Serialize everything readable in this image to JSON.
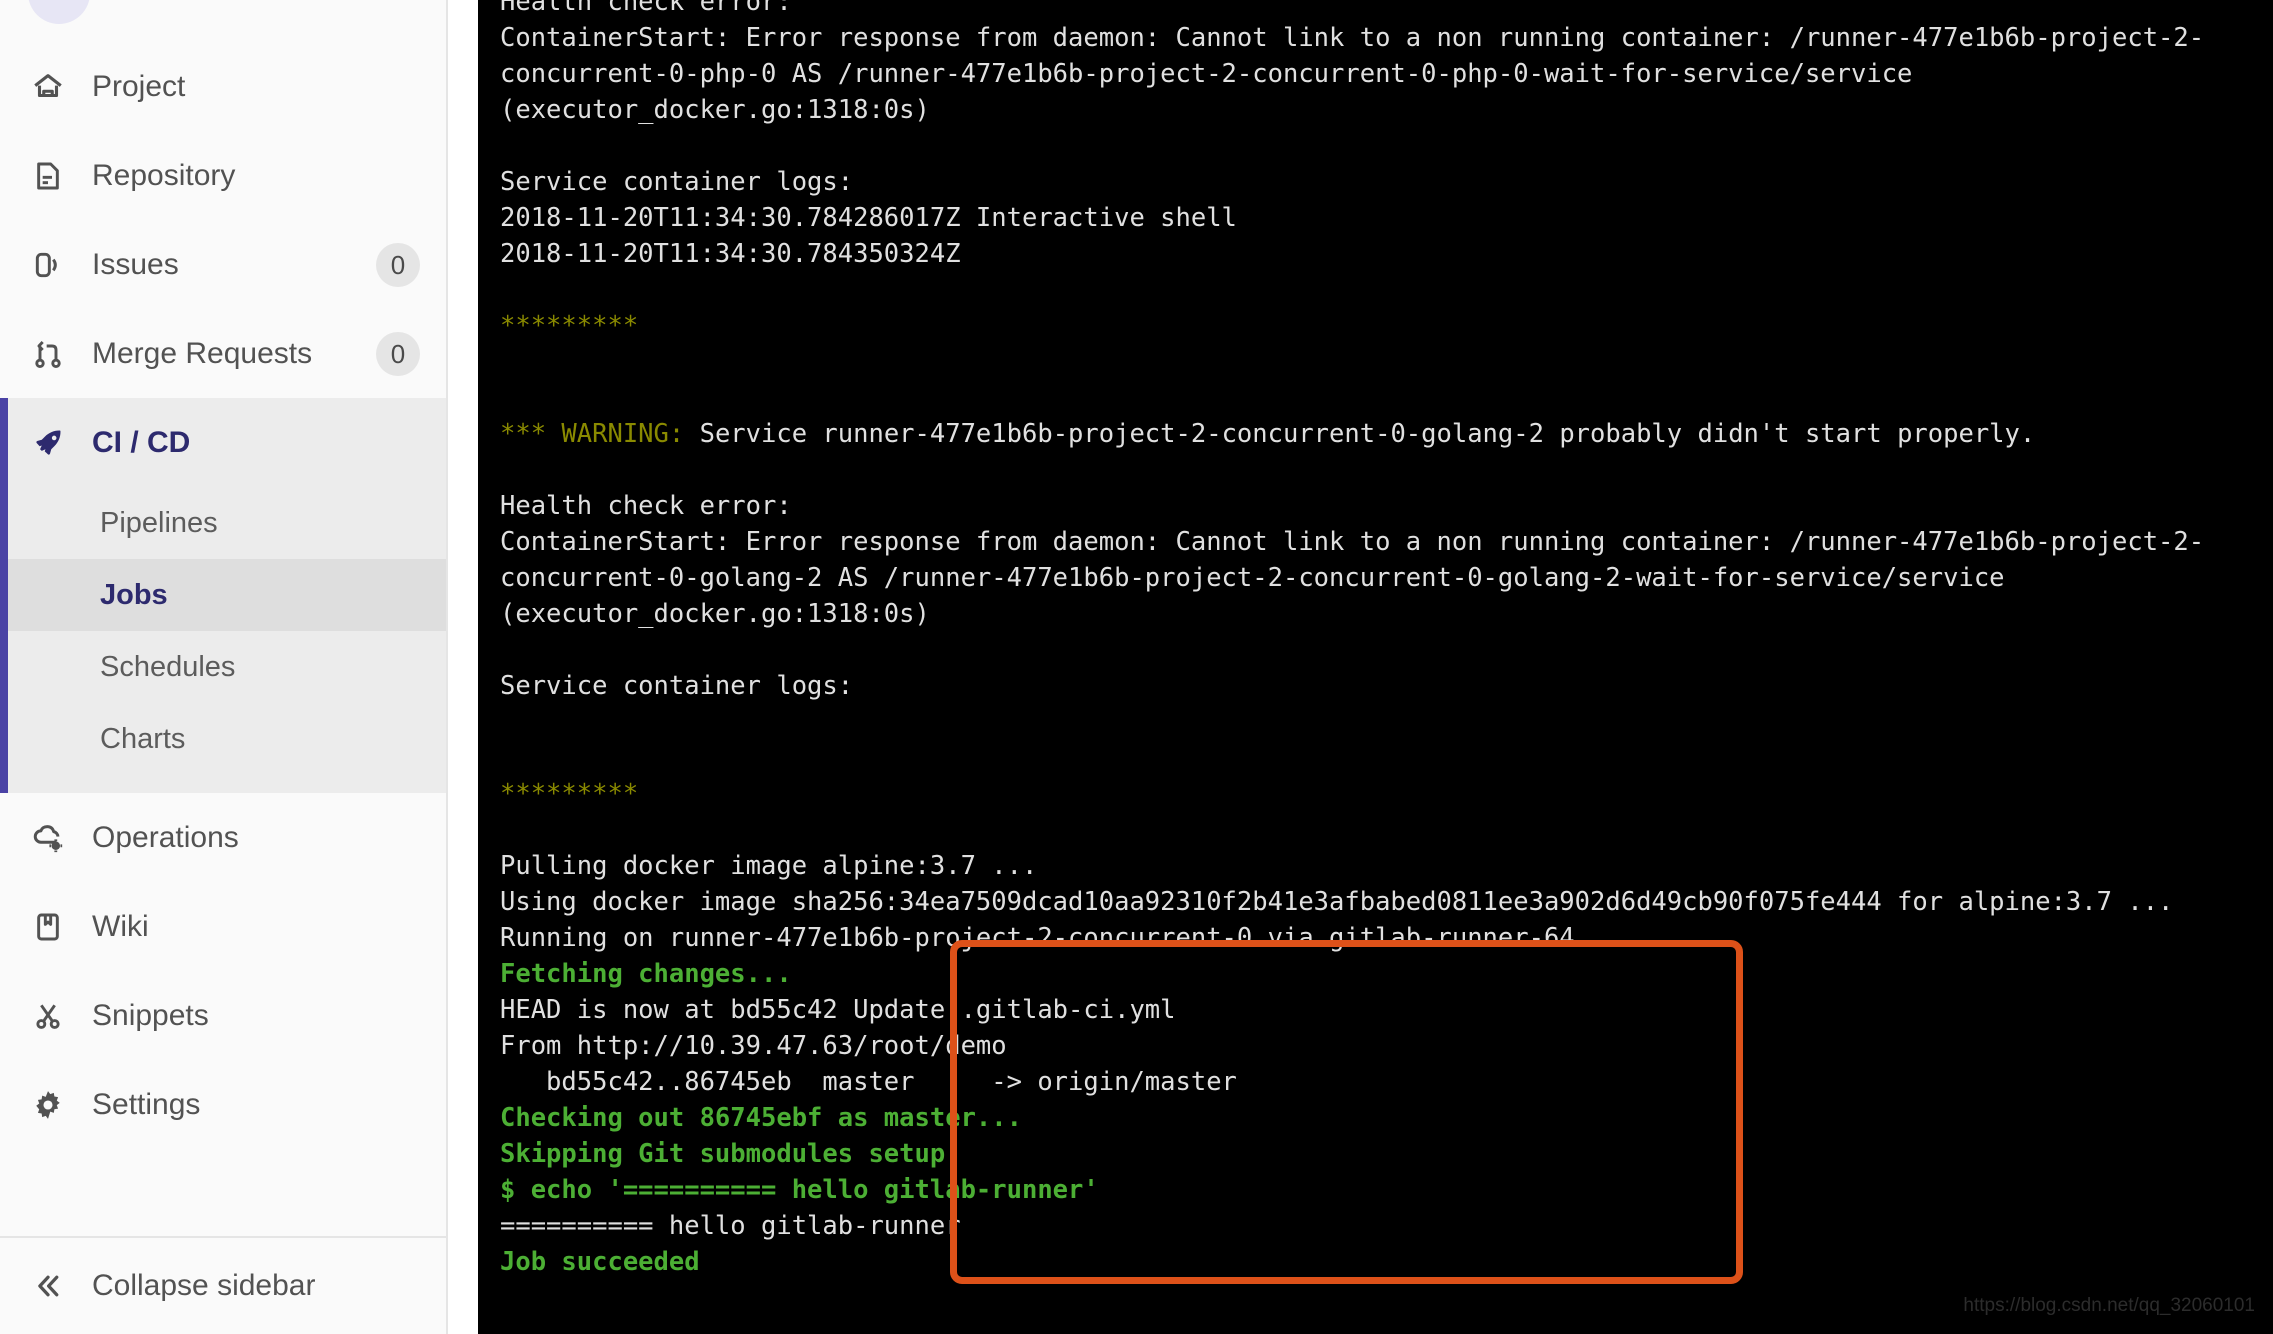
{
  "sidebar": {
    "avatar_name": "project-avatar",
    "items": [
      {
        "label": "Project",
        "icon": "home-icon",
        "badge": null
      },
      {
        "label": "Repository",
        "icon": "document-icon",
        "badge": null
      },
      {
        "label": "Issues",
        "icon": "issues-icon",
        "badge": "0"
      },
      {
        "label": "Merge Requests",
        "icon": "merge-request-icon",
        "badge": "0"
      },
      {
        "label": "CI / CD",
        "icon": "rocket-icon",
        "badge": null,
        "active": true
      },
      {
        "label": "Operations",
        "icon": "cloud-gear-icon",
        "badge": null
      },
      {
        "label": "Wiki",
        "icon": "book-icon",
        "badge": null
      },
      {
        "label": "Snippets",
        "icon": "snippet-icon",
        "badge": null
      },
      {
        "label": "Settings",
        "icon": "gear-icon",
        "badge": null
      }
    ],
    "cicd_subitems": [
      {
        "label": "Pipelines",
        "selected": false
      },
      {
        "label": "Jobs",
        "selected": true
      },
      {
        "label": "Schedules",
        "selected": false
      },
      {
        "label": "Charts",
        "selected": false
      }
    ],
    "collapse": {
      "label": "Collapse sidebar",
      "icon": "double-chevron-left-icon"
    }
  },
  "terminal": {
    "lines": [
      {
        "segments": [
          {
            "text": "Health check error:",
            "style": "white"
          }
        ]
      },
      {
        "segments": [
          {
            "text": "ContainerStart: Error response from daemon: Cannot link to a non running container: /runner-477e1b6b-project-2-",
            "style": "white"
          }
        ]
      },
      {
        "segments": [
          {
            "text": "concurrent-0-php-0 AS /runner-477e1b6b-project-2-concurrent-0-php-0-wait-for-service/service",
            "style": "white"
          }
        ]
      },
      {
        "segments": [
          {
            "text": "(executor_docker.go:1318:0s)",
            "style": "white"
          }
        ]
      },
      {
        "segments": []
      },
      {
        "segments": [
          {
            "text": "Service container logs:",
            "style": "white"
          }
        ]
      },
      {
        "segments": [
          {
            "text": "2018-11-20T11:34:30.784286017Z Interactive shell",
            "style": "white"
          }
        ]
      },
      {
        "segments": [
          {
            "text": "2018-11-20T11:34:30.784350324Z",
            "style": "white"
          }
        ]
      },
      {
        "segments": []
      },
      {
        "segments": [
          {
            "text": "*********",
            "style": "star"
          }
        ]
      },
      {
        "segments": []
      },
      {
        "segments": []
      },
      {
        "segments": [
          {
            "text": "*** WARNING:",
            "style": "warn"
          },
          {
            "text": " Service runner-477e1b6b-project-2-concurrent-0-golang-2 probably didn't start properly.",
            "style": "white"
          }
        ]
      },
      {
        "segments": []
      },
      {
        "segments": [
          {
            "text": "Health check error:",
            "style": "white"
          }
        ]
      },
      {
        "segments": [
          {
            "text": "ContainerStart: Error response from daemon: Cannot link to a non running container: /runner-477e1b6b-project-2-",
            "style": "white"
          }
        ]
      },
      {
        "segments": [
          {
            "text": "concurrent-0-golang-2 AS /runner-477e1b6b-project-2-concurrent-0-golang-2-wait-for-service/service",
            "style": "white"
          }
        ]
      },
      {
        "segments": [
          {
            "text": "(executor_docker.go:1318:0s)",
            "style": "white"
          }
        ]
      },
      {
        "segments": []
      },
      {
        "segments": [
          {
            "text": "Service container logs:",
            "style": "white"
          }
        ]
      },
      {
        "segments": []
      },
      {
        "segments": []
      },
      {
        "segments": [
          {
            "text": "*********",
            "style": "star"
          }
        ]
      },
      {
        "segments": []
      },
      {
        "segments": [
          {
            "text": "Pulling docker image alpine:3.7 ...",
            "style": "white"
          }
        ]
      },
      {
        "segments": [
          {
            "text": "Using docker image sha256:34ea7509dcad10aa92310f2b41e3afbabed0811ee3a902d6d49cb90f075fe444 for alpine:3.7 ...",
            "style": "white"
          }
        ]
      },
      {
        "segments": [
          {
            "text": "Running on runner-477e1b6b-project-2-concurrent-0 via gitlab-runner-64...",
            "style": "white"
          }
        ]
      },
      {
        "segments": [
          {
            "text": "Fetching changes...",
            "style": "green"
          }
        ]
      },
      {
        "segments": [
          {
            "text": "HEAD is now at bd55c42 Update .gitlab-ci.yml",
            "style": "white"
          }
        ]
      },
      {
        "segments": [
          {
            "text": "From http://10.39.47.63/root/demo",
            "style": "white"
          }
        ]
      },
      {
        "segments": [
          {
            "text": "   bd55c42..86745eb  master     -> origin/master",
            "style": "white"
          }
        ]
      },
      {
        "segments": [
          {
            "text": "Checking out 86745ebf as master...",
            "style": "green"
          }
        ]
      },
      {
        "segments": [
          {
            "text": "Skipping Git submodules setup",
            "style": "green"
          }
        ]
      },
      {
        "segments": [
          {
            "text": "$ echo '========== hello gitlab-runner'",
            "style": "green"
          }
        ]
      },
      {
        "segments": [
          {
            "text": "========== hello gitlab-runner",
            "style": "white"
          }
        ]
      },
      {
        "segments": [
          {
            "text": "Job succeeded",
            "style": "green"
          }
        ]
      }
    ],
    "highlight_color": "#dd5119",
    "green_color": "#4caf34",
    "warning_color": "#8a8a00"
  },
  "watermark": {
    "text": "https://blog.csdn.net/qq_32060101"
  }
}
